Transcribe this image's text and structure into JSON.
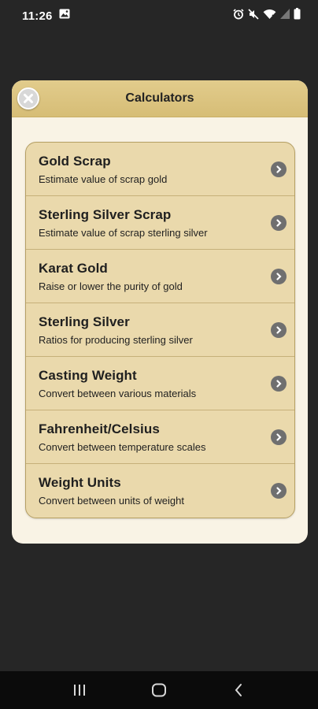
{
  "status_bar": {
    "time": "11:26",
    "left_icons": [
      "image-icon"
    ],
    "right_icons": [
      "alarm-icon",
      "mute-icon",
      "wifi-icon",
      "signal-icon",
      "battery-icon"
    ]
  },
  "modal": {
    "title": "Calculators",
    "close_icon": "close-icon",
    "header_color": "#dcc37f",
    "background_color": "#f9f3e5",
    "list_background_color": "#ead9ac"
  },
  "calculators": [
    {
      "title": "Gold Scrap",
      "subtitle": "Estimate value of scrap gold"
    },
    {
      "title": "Sterling Silver Scrap",
      "subtitle": "Estimate value of scrap sterling silver"
    },
    {
      "title": "Karat Gold",
      "subtitle": "Raise or lower the purity of gold"
    },
    {
      "title": "Sterling Silver",
      "subtitle": "Ratios for producing sterling silver"
    },
    {
      "title": "Casting Weight",
      "subtitle": "Convert between various materials"
    },
    {
      "title": "Fahrenheit/Celsius",
      "subtitle": "Convert between temperature scales"
    },
    {
      "title": "Weight Units",
      "subtitle": "Convert between units of weight"
    }
  ],
  "nav_bar": {
    "icons": [
      "recent-apps-icon",
      "home-icon",
      "back-icon"
    ]
  }
}
